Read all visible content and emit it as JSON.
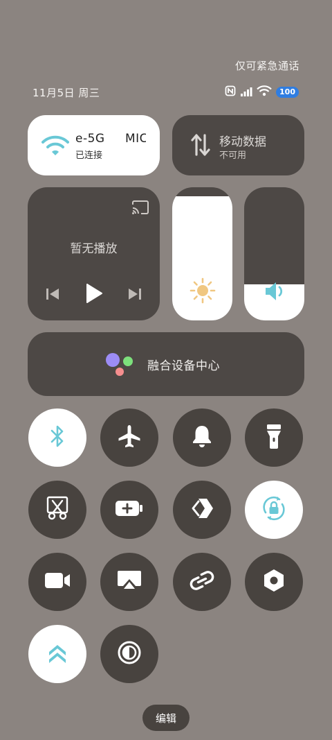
{
  "status_bar": {
    "emergency_text": "仅可紧急通话",
    "date_text": "11月5日 周三",
    "battery_level": "100"
  },
  "wifi": {
    "name_left": "e-5G",
    "name_right": "MIC",
    "status": "已连接",
    "accent": "#69c8d6"
  },
  "mobile_data": {
    "title": "移动数据",
    "status": "不可用"
  },
  "media": {
    "status": "暂无播放"
  },
  "brightness": {
    "level": 0.93,
    "icon": "sun-icon",
    "icon_color": "#f0c781"
  },
  "volume": {
    "level": 0.27,
    "icon": "speaker-icon",
    "icon_color": "#69c8d6"
  },
  "device_hub": {
    "label": "融合设备中心"
  },
  "toggles": [
    {
      "name": "bluetooth",
      "icon": "bluetooth-icon",
      "on": true
    },
    {
      "name": "airplane-mode",
      "icon": "airplane-icon",
      "on": false
    },
    {
      "name": "ring-mode",
      "icon": "bell-icon",
      "on": false
    },
    {
      "name": "flashlight",
      "icon": "flashlight-icon",
      "on": false
    },
    {
      "name": "screenshot",
      "icon": "scissors-icon",
      "on": false
    },
    {
      "name": "battery-saver",
      "icon": "battery-plus-icon",
      "on": false
    },
    {
      "name": "nearby-share",
      "icon": "share-arrow-icon",
      "on": false
    },
    {
      "name": "rotation-lock",
      "icon": "rotation-lock-icon",
      "on": true
    },
    {
      "name": "screen-record",
      "icon": "video-camera-icon",
      "on": false
    },
    {
      "name": "screen-cast",
      "icon": "cast-screen-icon",
      "on": false
    },
    {
      "name": "link",
      "icon": "link-icon",
      "on": false
    },
    {
      "name": "settings-hex",
      "icon": "hex-nut-icon",
      "on": false
    },
    {
      "name": "performance-mode",
      "icon": "double-chevron-up-icon",
      "on": true
    },
    {
      "name": "dark-mode",
      "icon": "contrast-icon",
      "on": false
    }
  ],
  "edit_label": "编辑"
}
